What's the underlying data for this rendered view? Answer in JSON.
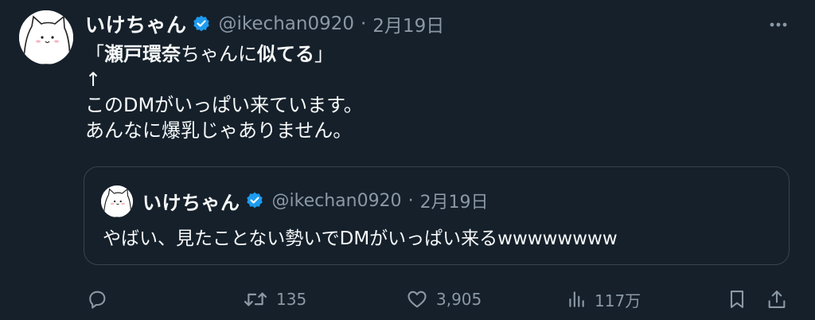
{
  "tweet": {
    "author": {
      "display_name": "いけちゃん",
      "handle": "@ikechan0920",
      "verified": true
    },
    "dot": "·",
    "date": "2月19日",
    "body": {
      "line1_open": "「",
      "line1_bold1": "瀬戸環奈",
      "line1_mid": "ちゃんに",
      "line1_bold2": "似てる",
      "line1_close": "」",
      "line2": "↑",
      "line3": "このDMがいっぱい来ています。",
      "line4": "あんなに爆乳じゃありません。"
    },
    "quoted": {
      "display_name": "いけちゃん",
      "handle": "@ikechan0920",
      "dot": "·",
      "date": "2月19日",
      "text": "やばい、見たことない勢いでDMがいっぱい来るwwwwwwww"
    },
    "stats": {
      "retweets": "135",
      "likes": "3,905",
      "views": "117万"
    },
    "colors": {
      "background": "#15202b",
      "verified_blue": "#1d9bf0",
      "muted": "#8b98a5"
    },
    "icons": [
      "more-icon",
      "verified-badge-icon",
      "reply-icon",
      "retweet-icon",
      "like-icon",
      "views-icon",
      "bookmark-icon",
      "share-icon"
    ]
  }
}
